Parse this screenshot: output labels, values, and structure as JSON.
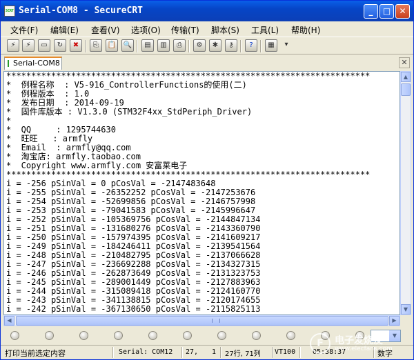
{
  "window": {
    "title": "Serial-COM8 - SecureCRT",
    "app_icon": "SCRT"
  },
  "title_buttons": {
    "minimize": "_",
    "maximize": "□",
    "close": "✕"
  },
  "menu": [
    "文件(F)",
    "编辑(E)",
    "查看(V)",
    "选项(O)",
    "传输(T)",
    "脚本(S)",
    "工具(L)",
    "帮助(H)"
  ],
  "toolbar_icons": [
    "connect-icon",
    "quick-connect-icon",
    "connect-tab-icon",
    "reconnect-icon",
    "disconnect-icon",
    "copy-icon",
    "paste-icon",
    "find-icon",
    "print-icon",
    "print-setup-icon",
    "print-screen-icon",
    "session-options-icon",
    "global-options-icon",
    "keymap-icon",
    "help-icon",
    "sftp-icon",
    "more-icon"
  ],
  "tab": {
    "label": "Serial-COM8",
    "close": "✕"
  },
  "terminal_lines": [
    "*************************************************************************",
    "*  例程名称  : V5-916_ControllerFunctions的使用(二)",
    "*  例程版本  : 1.0",
    "*  发布日期  : 2014-09-19",
    "*  固件库版本 : V1.3.0 (STM32F4xx_StdPeriph_Driver)",
    "*",
    "*  QQ     : 1295744630",
    "*  旺旺   : armfly",
    "*  Email  : armfly@qq.com",
    "*  淘宝店: armfly.taobao.com",
    "*  Copyright www.armfly.com 安富莱电子",
    "*************************************************************************",
    "i = -256 pSinVal = 0 pCosVal = -2147483648",
    "i = -255 pSinVal = -26352252 pCosVal = -2147253676",
    "i = -254 pSinVal = -52699856 pCosVal = -2146757998",
    "i = -253 pSinVal = -79041583 pCosVal = -2145996647",
    "i = -252 pSinVal = -105369756 pCosVal = -2144847134",
    "i = -251 pSinVal = -131680276 pCosVal = -2143360790",
    "i = -250 pSinVal = -157974395 pCosVal = -2141609217",
    "i = -249 pSinVal = -184246411 pCosVal = -2139541564",
    "i = -248 pSinVal = -210482795 pCosVal = -2137066628",
    "i = -247 pSinVal = -236692288 pCosVal = -2134327315",
    "i = -246 pSinVal = -262873649 pCosVal = -2131323753",
    "i = -245 pSinVal = -289001449 pCosVal = -2127883963",
    "i = -244 pSinVal = -315089418 pCosVal = -2124160770",
    "i = -243 pSinVal = -341138815 pCosVal = -2120174655",
    "i = -242 pSinVal = -367130650 pCosVal = -2115825113"
  ],
  "status": {
    "message": "打印当前选定内容",
    "port": "Serial: COM12",
    "row": "27,",
    "col": "1",
    "rows_cols": "27行, 71列",
    "terminal": "VT100",
    "time": "05:38:37",
    "mode": "数字"
  },
  "watermark": {
    "logo": "F",
    "text": "电子发烧友",
    "url": "www.elecfans.com"
  }
}
